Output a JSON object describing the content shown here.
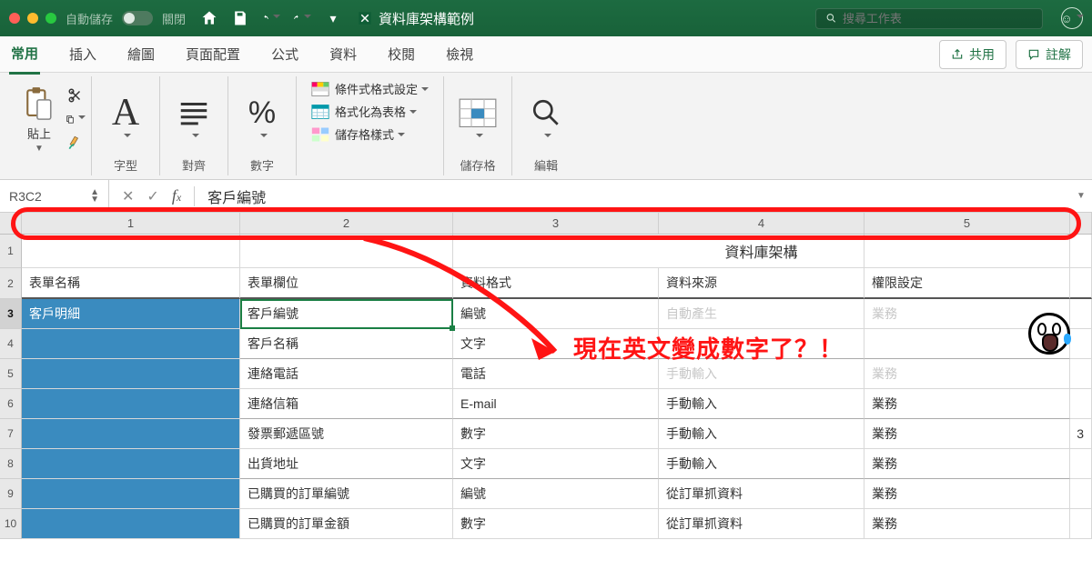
{
  "titlebar": {
    "autosave_label": "自動儲存",
    "autosave_state": "關閉",
    "doc_title": "資料庫架構範例",
    "search_placeholder": "搜尋工作表"
  },
  "tabs": {
    "items": [
      "常用",
      "插入",
      "繪圖",
      "頁面配置",
      "公式",
      "資料",
      "校閱",
      "檢視"
    ],
    "active_index": 0,
    "share": "共用",
    "comment": "註解"
  },
  "ribbon": {
    "paste": "貼上",
    "font": "字型",
    "align": "對齊",
    "number": "數字",
    "styles": {
      "cond_fmt": "條件式格式設定",
      "as_table": "格式化為表格",
      "cell_styles": "儲存格樣式"
    },
    "cells": "儲存格",
    "editing": "編輯"
  },
  "formula_bar": {
    "name_box": "R3C2",
    "value": "客戶編號"
  },
  "column_headers": [
    "1",
    "2",
    "3",
    "4",
    "5"
  ],
  "sheet": {
    "title": "資料庫架構",
    "headers": [
      "表單名稱",
      "表單欄位",
      "資料格式",
      "資料來源",
      "權限設定"
    ],
    "first_col": "客戶明細",
    "rows": [
      {
        "c2": "客戶編號",
        "c3": "編號",
        "c4": "自動產生",
        "c5": "業務",
        "dim45": true
      },
      {
        "c2": "客戶名稱",
        "c3": "文字",
        "c4": "",
        "c5": ""
      },
      {
        "c2": "連絡電話",
        "c3": "電話",
        "c4": "手動輸入",
        "c5": "業務",
        "dim45": true
      },
      {
        "c2": "連絡信箱",
        "c3": "E-mail",
        "c4": "手動輸入",
        "c5": "業務"
      },
      {
        "c2": "發票郵遞區號",
        "c3": "數字",
        "c4": "手動輸入",
        "c5": "業務"
      },
      {
        "c2": "出貨地址",
        "c3": "文字",
        "c4": "手動輸入",
        "c5": "業務"
      },
      {
        "c2": "已購買的訂單編號",
        "c3": "編號",
        "c4": "從訂單抓資料",
        "c5": "業務"
      },
      {
        "c2": "已購買的訂單金額",
        "c3": "數字",
        "c4": "從訂單抓資料",
        "c5": "業務"
      }
    ],
    "extra_col6_row7": "3"
  },
  "annotation": {
    "text": "現在英文變成數字了？！"
  }
}
